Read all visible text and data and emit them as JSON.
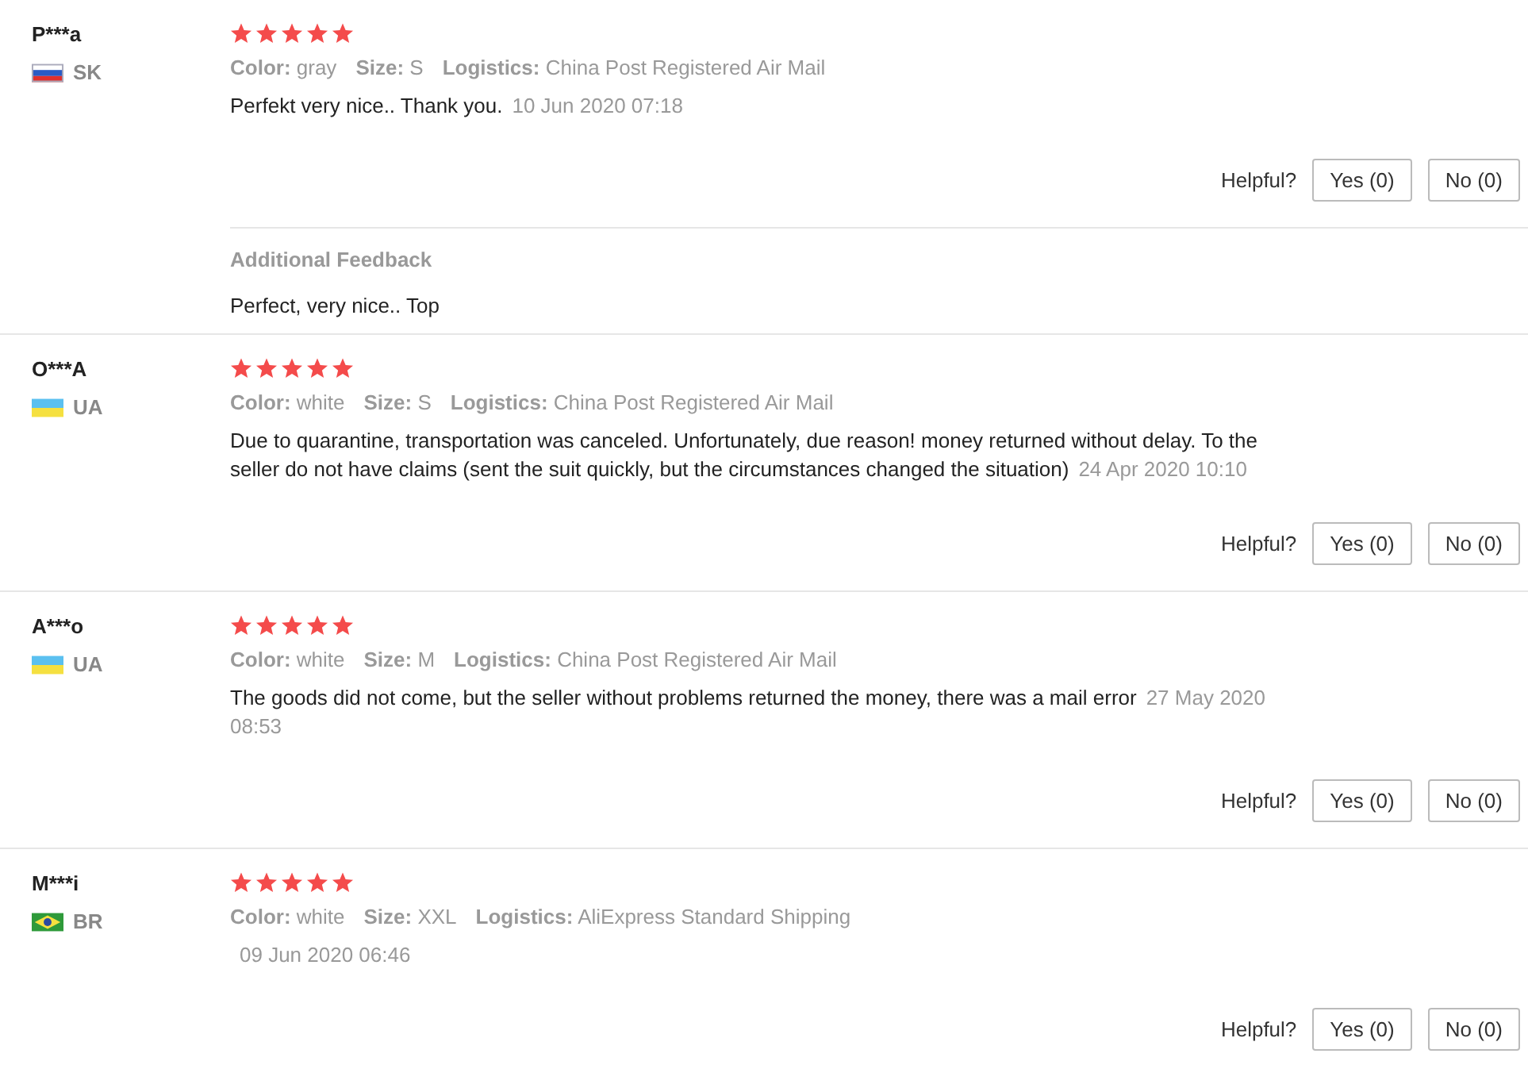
{
  "reviews": [
    {
      "user": "P***a",
      "country": "SK",
      "flag": {
        "kind": "slovak"
      },
      "stars": 5,
      "attributes": [
        {
          "label": "Color:",
          "value": "gray"
        },
        {
          "label": "Size:",
          "value": "S"
        },
        {
          "label": "Logistics:",
          "value": "China Post Registered Air Mail"
        }
      ],
      "message": "Perfekt very nice.. Thank you.",
      "date": "10 Jun 2020 07:18",
      "helpful_label": "Helpful?",
      "yes": "Yes (0)",
      "no": "No (0)",
      "additional": {
        "title": "Additional Feedback",
        "text": "Perfect, very nice.. Top"
      }
    },
    {
      "user": "O***A",
      "country": "UA",
      "flag": {
        "kind": "ukrainian"
      },
      "stars": 5,
      "attributes": [
        {
          "label": "Color:",
          "value": "white"
        },
        {
          "label": "Size:",
          "value": "S"
        },
        {
          "label": "Logistics:",
          "value": "China Post Registered Air Mail"
        }
      ],
      "message": "Due to quarantine, transportation was canceled. Unfortunately, due reason! money returned without delay. To the seller do not have claims (sent the suit quickly, but the circumstances changed the situation)",
      "date": "24 Apr 2020 10:10",
      "helpful_label": "Helpful?",
      "yes": "Yes (0)",
      "no": "No (0)"
    },
    {
      "user": "A***o",
      "country": "UA",
      "flag": {
        "kind": "ukrainian"
      },
      "stars": 5,
      "attributes": [
        {
          "label": "Color:",
          "value": "white"
        },
        {
          "label": "Size:",
          "value": "M"
        },
        {
          "label": "Logistics:",
          "value": "China Post Registered Air Mail"
        }
      ],
      "message": "The goods did not come, but the seller without problems returned the money, there was a mail error",
      "date": "27 May 2020 08:53",
      "helpful_label": "Helpful?",
      "yes": "Yes (0)",
      "no": "No (0)"
    },
    {
      "user": "M***i",
      "country": "BR",
      "flag": {
        "kind": "brazilian"
      },
      "stars": 5,
      "attributes": [
        {
          "label": "Color:",
          "value": "white"
        },
        {
          "label": "Size:",
          "value": "XXL"
        },
        {
          "label": "Logistics:",
          "value": "AliExpress Standard Shipping"
        }
      ],
      "date": "09 Jun 2020 06:46",
      "helpful_label": "Helpful?",
      "yes": "Yes (0)",
      "no": "No (0)"
    }
  ]
}
